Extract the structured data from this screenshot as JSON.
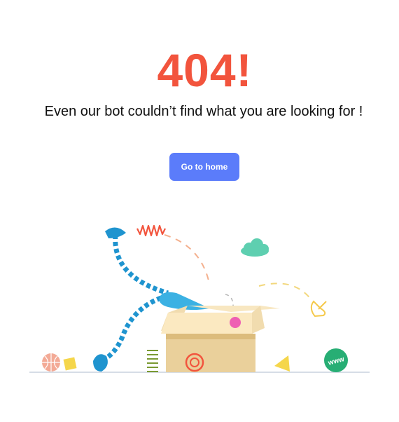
{
  "error": {
    "code_text": "404!",
    "message": "Even our bot couldn’t find what you are looking for !"
  },
  "actions": {
    "home_button_label": "Go to home"
  },
  "illustration": {
    "spring_text": "WWWW",
    "globe_text": "www",
    "icons": [
      "box-icon",
      "robot-arm-icon",
      "cloud-icon",
      "pointing-hand-icon",
      "globe-icon",
      "spring-icon",
      "spiral-icon",
      "triangle-icon",
      "cube-icon",
      "ball-icon"
    ]
  },
  "colors": {
    "accent_red": "#f2543d",
    "button_blue": "#5b7cfa",
    "arm_blue": "#1f94cf",
    "box_tan": "#f6dfa8",
    "cloud_green": "#5ecfb0",
    "globe_green": "#27ae74",
    "pink": "#ee5fb3",
    "yellow": "#f5d64b"
  }
}
